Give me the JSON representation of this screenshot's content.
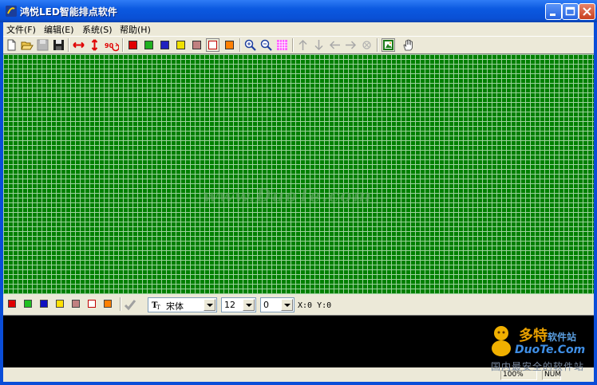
{
  "window": {
    "title": "鸿悦LED智能排点软件"
  },
  "menu": [
    {
      "label": "文件(F)"
    },
    {
      "label": "编辑(E)"
    },
    {
      "label": "系统(S)"
    },
    {
      "label": "帮助(H)"
    }
  ],
  "toolbar": {
    "icons": [
      "new-file-icon",
      "open-folder-icon",
      "save-disabled-icon",
      "save-icon",
      "stretch-horizontal-icon",
      "stretch-vertical-icon",
      "rotate-90-icon",
      "swatch-red-icon",
      "swatch-green-icon",
      "swatch-blue-icon",
      "swatch-yellow-icon",
      "swatch-pink-icon",
      "swatch-white-icon",
      "swatch-orange-icon",
      "zoom-in-icon",
      "zoom-out-icon",
      "grid-icon",
      "arrow-up-icon",
      "arrow-down-icon",
      "arrow-left-icon",
      "arrow-right-icon",
      "stop-icon",
      "image-icon",
      "hand-icon"
    ],
    "swatches": [
      "#e00000",
      "#20b020",
      "#2020c0",
      "#f0e000",
      "#c08080",
      "#ffffff",
      "#ff8000"
    ]
  },
  "canvas": {
    "watermark": "www.DuoTe.com",
    "grid_color": "#008000",
    "line_color": "#9fd29f"
  },
  "bottom": {
    "colors": [
      "#e00000",
      "#20c020",
      "#1010c0",
      "#ffe000",
      "#c08080",
      "#ffffff",
      "#ff8000"
    ],
    "font_icon": "font-icon",
    "font_name": "宋体",
    "font_size": "12",
    "third_value": "0",
    "coords": "X:0 Y:0"
  },
  "status": {
    "zoom": "100%",
    "num": "NUM"
  },
  "logo": {
    "line1": "多特",
    "line1_suffix": "软件站",
    "line2": "DuoTe.Com",
    "line3": "国内最安全的软件站"
  }
}
